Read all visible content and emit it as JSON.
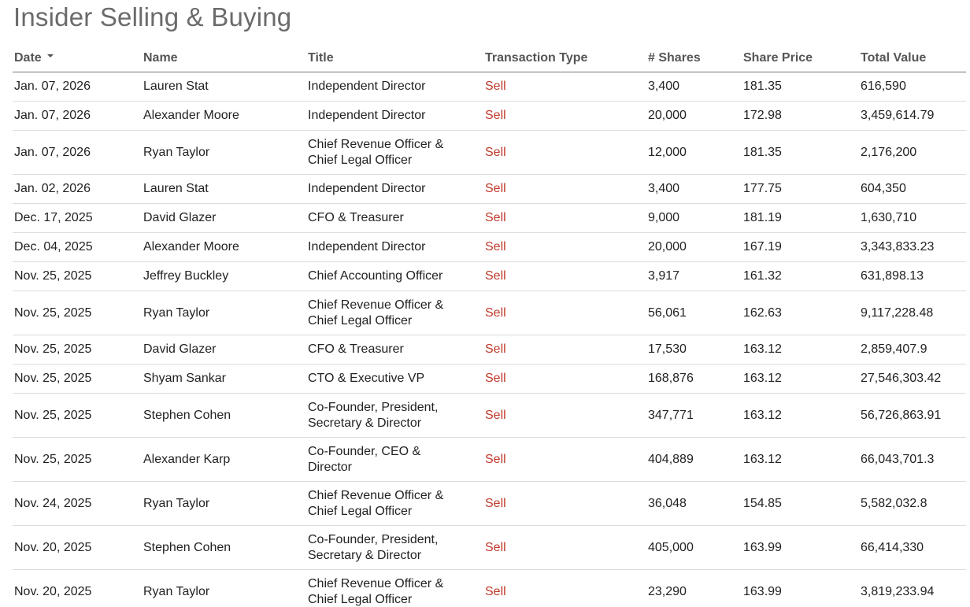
{
  "page_title": "Insider Selling & Buying",
  "table": {
    "headers": {
      "date": "Date",
      "name": "Name",
      "title": "Title",
      "transaction_type": "Transaction Type",
      "shares": "# Shares",
      "share_price": "Share Price",
      "total_value": "Total Value"
    },
    "sort": {
      "column": "Date",
      "direction": "descending",
      "icon": "caret-down-icon"
    },
    "type_color": "#c0392b",
    "rows": [
      {
        "date": "Jan. 07, 2026",
        "name": "Lauren Stat",
        "title_lines": [
          "Independent Director"
        ],
        "type": "Sell",
        "shares": "3,400",
        "price": "181.35",
        "value": "616,590"
      },
      {
        "date": "Jan. 07, 2026",
        "name": "Alexander Moore",
        "title_lines": [
          "Independent Director"
        ],
        "type": "Sell",
        "shares": "20,000",
        "price": "172.98",
        "value": "3,459,614.79"
      },
      {
        "date": "Jan. 07, 2026",
        "name": "Ryan Taylor",
        "title_lines": [
          "Chief Revenue Officer &",
          "Chief Legal Officer"
        ],
        "type": "Sell",
        "shares": "12,000",
        "price": "181.35",
        "value": "2,176,200"
      },
      {
        "date": "Jan. 02, 2026",
        "name": "Lauren Stat",
        "title_lines": [
          "Independent Director"
        ],
        "type": "Sell",
        "shares": "3,400",
        "price": "177.75",
        "value": "604,350"
      },
      {
        "date": "Dec. 17, 2025",
        "name": "David Glazer",
        "title_lines": [
          "CFO & Treasurer"
        ],
        "type": "Sell",
        "shares": "9,000",
        "price": "181.19",
        "value": "1,630,710"
      },
      {
        "date": "Dec. 04, 2025",
        "name": "Alexander Moore",
        "title_lines": [
          "Independent Director"
        ],
        "type": "Sell",
        "shares": "20,000",
        "price": "167.19",
        "value": "3,343,833.23"
      },
      {
        "date": "Nov. 25, 2025",
        "name": "Jeffrey Buckley",
        "title_lines": [
          "Chief Accounting Officer"
        ],
        "type": "Sell",
        "shares": "3,917",
        "price": "161.32",
        "value": "631,898.13"
      },
      {
        "date": "Nov. 25, 2025",
        "name": "Ryan Taylor",
        "title_lines": [
          "Chief Revenue Officer &",
          "Chief Legal Officer"
        ],
        "type": "Sell",
        "shares": "56,061",
        "price": "162.63",
        "value": "9,117,228.48"
      },
      {
        "date": "Nov. 25, 2025",
        "name": "David Glazer",
        "title_lines": [
          "CFO & Treasurer"
        ],
        "type": "Sell",
        "shares": "17,530",
        "price": "163.12",
        "value": "2,859,407.9"
      },
      {
        "date": "Nov. 25, 2025",
        "name": "Shyam Sankar",
        "title_lines": [
          "CTO & Executive VP"
        ],
        "type": "Sell",
        "shares": "168,876",
        "price": "163.12",
        "value": "27,546,303.42"
      },
      {
        "date": "Nov. 25, 2025",
        "name": "Stephen Cohen",
        "title_lines": [
          "Co-Founder, President,",
          "Secretary & Director"
        ],
        "type": "Sell",
        "shares": "347,771",
        "price": "163.12",
        "value": "56,726,863.91"
      },
      {
        "date": "Nov. 25, 2025",
        "name": "Alexander Karp",
        "title_lines": [
          "Co-Founder, CEO &",
          "Director"
        ],
        "type": "Sell",
        "shares": "404,889",
        "price": "163.12",
        "value": "66,043,701.3"
      },
      {
        "date": "Nov. 24, 2025",
        "name": "Ryan Taylor",
        "title_lines": [
          "Chief Revenue Officer &",
          "Chief Legal Officer"
        ],
        "type": "Sell",
        "shares": "36,048",
        "price": "154.85",
        "value": "5,582,032.8"
      },
      {
        "date": "Nov. 20, 2025",
        "name": "Stephen Cohen",
        "title_lines": [
          "Co-Founder, President,",
          "Secretary & Director"
        ],
        "type": "Sell",
        "shares": "405,000",
        "price": "163.99",
        "value": "66,414,330"
      },
      {
        "date": "Nov. 20, 2025",
        "name": "Ryan Taylor",
        "title_lines": [
          "Chief Revenue Officer &",
          "Chief Legal Officer"
        ],
        "type": "Sell",
        "shares": "23,290",
        "price": "163.99",
        "value": "3,819,233.94"
      }
    ]
  }
}
